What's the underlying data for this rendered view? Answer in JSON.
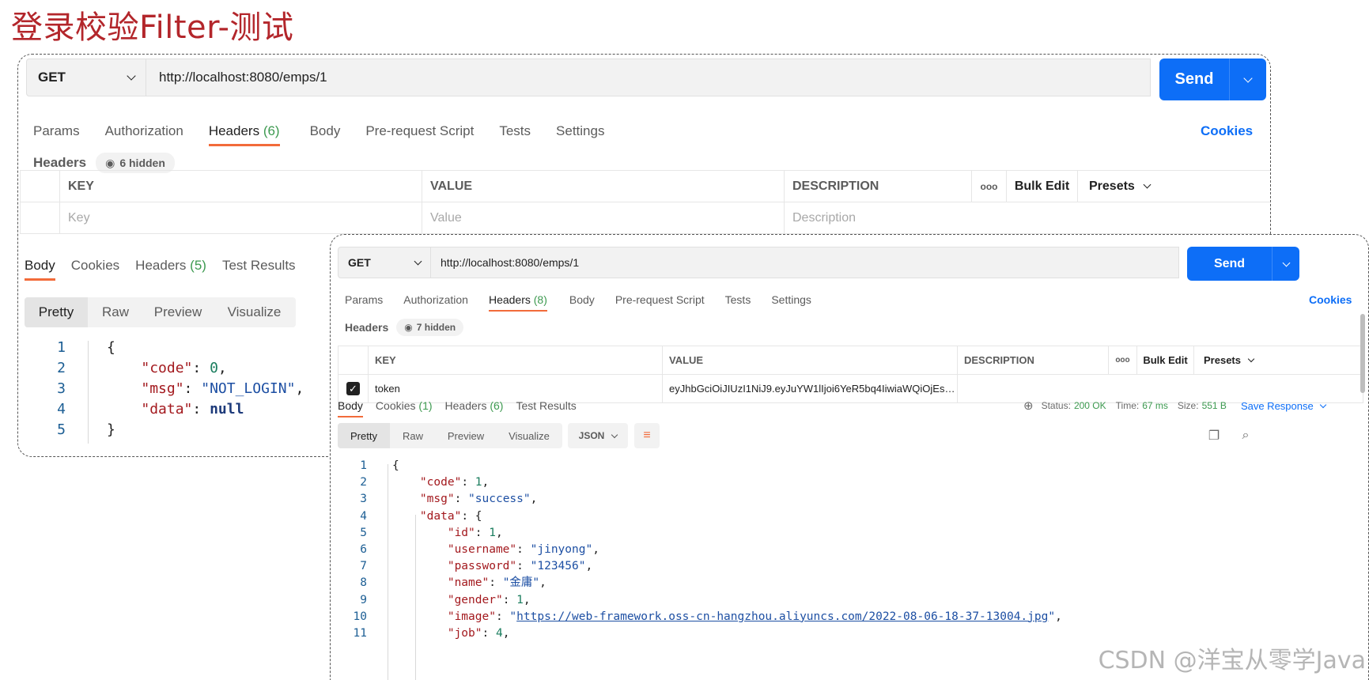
{
  "title": "登录校验Filter-测试",
  "panelA": {
    "method": "GET",
    "url": "http://localhost:8080/emps/1",
    "send": "Send",
    "tabs": [
      {
        "label": "Params",
        "count": ""
      },
      {
        "label": "Authorization",
        "count": ""
      },
      {
        "label": "Headers",
        "count": "(6)"
      },
      {
        "label": "Body",
        "count": ""
      },
      {
        "label": "Pre-request Script",
        "count": ""
      },
      {
        "label": "Tests",
        "count": ""
      },
      {
        "label": "Settings",
        "count": ""
      }
    ],
    "cookies": "Cookies",
    "headers_label": "Headers",
    "hidden": "6 hidden",
    "table": {
      "key": "KEY",
      "value": "VALUE",
      "description": "DESCRIPTION",
      "more": "ooo",
      "bulk": "Bulk Edit",
      "presets": "Presets",
      "key_ph": "Key",
      "value_ph": "Value",
      "desc_ph": "Description"
    },
    "resp_tabs": [
      {
        "label": "Body",
        "count": ""
      },
      {
        "label": "Cookies",
        "count": ""
      },
      {
        "label": "Headers",
        "count": "(5)"
      },
      {
        "label": "Test Results",
        "count": ""
      }
    ],
    "views": [
      "Pretty",
      "Raw",
      "Preview",
      "Visualize"
    ],
    "code": {
      "ln": [
        "1",
        "2",
        "3",
        "4",
        "5"
      ],
      "open": "{",
      "close": "}",
      "k_code": "\"code\"",
      "v_code": "0",
      "k_msg": "\"msg\"",
      "v_msg": "\"NOT_LOGIN\"",
      "k_data": "\"data\"",
      "v_data": "null"
    }
  },
  "panelB": {
    "method": "GET",
    "url": "http://localhost:8080/emps/1",
    "send": "Send",
    "tabs": [
      {
        "label": "Params",
        "count": ""
      },
      {
        "label": "Authorization",
        "count": ""
      },
      {
        "label": "Headers",
        "count": "(8)"
      },
      {
        "label": "Body",
        "count": ""
      },
      {
        "label": "Pre-request Script",
        "count": ""
      },
      {
        "label": "Tests",
        "count": ""
      },
      {
        "label": "Settings",
        "count": ""
      }
    ],
    "cookies": "Cookies",
    "headers_label": "Headers",
    "hidden": "7 hidden",
    "table": {
      "key": "KEY",
      "value": "VALUE",
      "description": "DESCRIPTION",
      "more": "ooo",
      "bulk": "Bulk Edit",
      "presets": "Presets",
      "row_key": "token",
      "row_value": "eyJhbGciOiJIUzI1NiJ9.eyJuYW1lIjoi6YeR5bq4IiwiaWQiOjEsInV..."
    },
    "resp_tabs": [
      {
        "label": "Body",
        "count": ""
      },
      {
        "label": "Cookies",
        "count": "(1)"
      },
      {
        "label": "Headers",
        "count": "(6)"
      },
      {
        "label": "Test Results",
        "count": ""
      }
    ],
    "status_label": "Status:",
    "status": "200 OK",
    "time_label": "Time:",
    "time": "67 ms",
    "size_label": "Size:",
    "size": "551 B",
    "save": "Save Response",
    "views": [
      "Pretty",
      "Raw",
      "Preview",
      "Visualize"
    ],
    "format": "JSON",
    "code": {
      "ln": [
        "1",
        "2",
        "3",
        "4",
        "5",
        "6",
        "7",
        "8",
        "9",
        "10",
        "11"
      ],
      "open": "{",
      "k_code": "\"code\"",
      "v_code": "1",
      "k_msg": "\"msg\"",
      "v_msg": "\"success\"",
      "k_data": "\"data\"",
      "k_id": "\"id\"",
      "v_id": "1",
      "k_username": "\"username\"",
      "v_username": "\"jinyong\"",
      "k_password": "\"password\"",
      "v_password": "\"123456\"",
      "k_name": "\"name\"",
      "v_name": "\"金庸\"",
      "k_gender": "\"gender\"",
      "v_gender": "1",
      "k_image": "\"image\"",
      "v_image_url": "https://web-framework.oss-cn-hangzhou.aliyuncs.com/2022-08-06-18-37-13004.jpg",
      "k_job": "\"job\"",
      "v_job": "4"
    }
  },
  "watermark": "CSDN @洋宝从零学Java",
  "colors": {
    "accent": "#0d6ef7",
    "tab_underline": "#f26b3a",
    "title": "#b3262b",
    "status_ok": "#3d9a50"
  }
}
